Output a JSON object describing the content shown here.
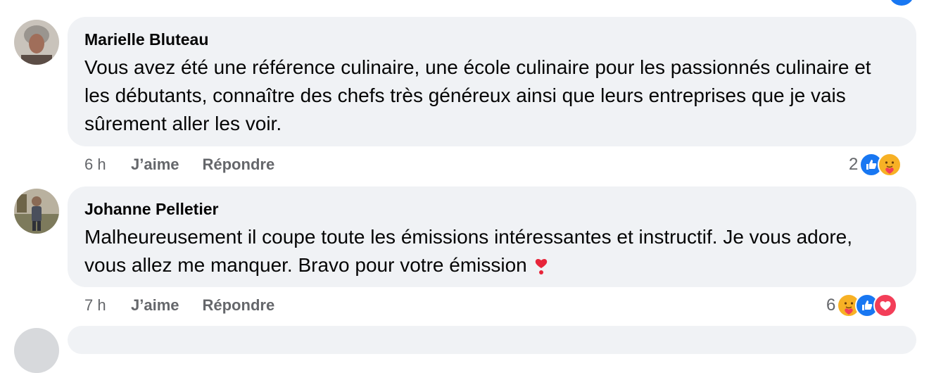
{
  "comments": [
    {
      "author": "Marielle Bluteau",
      "text": "Vous avez été une référence culinaire, une école culinaire pour les passionnés culinaire et les débutants, connaître des chefs très généreux ainsi que leurs entreprises que je vais sûrement aller les voir.",
      "time": "6 h",
      "like_label": "J’aime",
      "reply_label": "Répondre",
      "reaction_count": "2",
      "reactions": [
        "like-icon",
        "care-icon"
      ]
    },
    {
      "author": "Johanne Pelletier",
      "text": "Malheureusement il coupe toute les émissions intéressantes et instructif. Je vous adore, vous allez me manquer. Bravo pour votre émission",
      "emoji": "heart-exclamation-icon",
      "time": "7 h",
      "like_label": "J’aime",
      "reply_label": "Répondre",
      "reaction_count": "6",
      "reactions": [
        "care-icon",
        "like-icon",
        "love-icon"
      ]
    }
  ],
  "colors": {
    "bubble": "#f0f2f5",
    "meta_text": "#65676b",
    "like_blue": "#1877f2",
    "love_red": "#f33e58",
    "care_yellow": "#f7b125"
  }
}
